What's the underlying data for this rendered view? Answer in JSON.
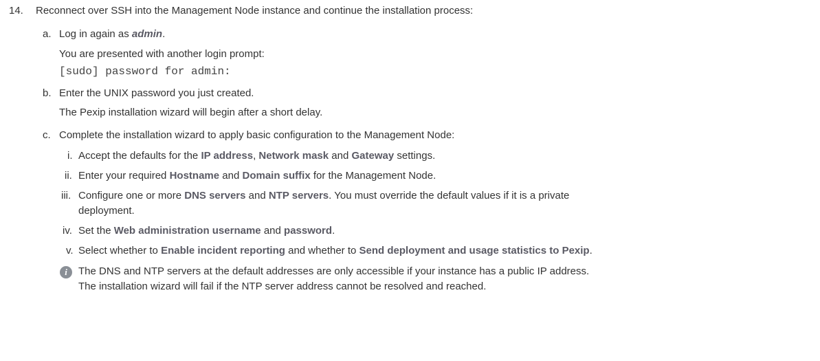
{
  "step": {
    "number": "14.",
    "text": "Reconnect over SSH into the Management Node instance and continue the installation process:"
  },
  "substeps": {
    "a": {
      "marker": "a.",
      "prefix": "Log in again as ",
      "emphasis": "admin",
      "suffix": ".",
      "note": "You are presented with another login prompt:",
      "code": "[sudo] password for admin:"
    },
    "b": {
      "marker": "b.",
      "text": "Enter the UNIX password you just created.",
      "note": "The Pexip installation wizard will begin after a short delay."
    },
    "c": {
      "marker": "c.",
      "text": "Complete the installation wizard to apply basic configuration to the Management Node:",
      "items": {
        "i": {
          "marker": "i.",
          "t1": "Accept the defaults for the ",
          "b1": "IP address",
          "t2": ", ",
          "b2": "Network mask",
          "t3": " and ",
          "b3": "Gateway",
          "t4": " settings."
        },
        "ii": {
          "marker": "ii.",
          "t1": "Enter your required ",
          "b1": "Hostname",
          "t2": " and ",
          "b2": "Domain suffix",
          "t3": " for the Management Node."
        },
        "iii": {
          "marker": "iii.",
          "t1": "Configure one or more ",
          "b1": "DNS servers",
          "t2": " and ",
          "b2": "NTP servers",
          "t3": ". You must override the default values if it is a private",
          "t4": "deployment."
        },
        "iv": {
          "marker": "iv.",
          "t1": "Set the ",
          "b1": "Web administration username",
          "t2": " and ",
          "b2": "password",
          "t3": "."
        },
        "v": {
          "marker": "v.",
          "t1": "Select whether to ",
          "b1": "Enable incident reporting",
          "t2": " and whether to ",
          "b2": "Send deployment and usage statistics to Pexip",
          "t3": "."
        }
      }
    }
  },
  "info": {
    "icon": "info-icon",
    "glyph": "i",
    "line1": "The DNS and NTP servers at the default addresses are only accessible if your instance has a public IP address.",
    "line2": "The installation wizard will fail if the NTP server address cannot be resolved and reached."
  }
}
